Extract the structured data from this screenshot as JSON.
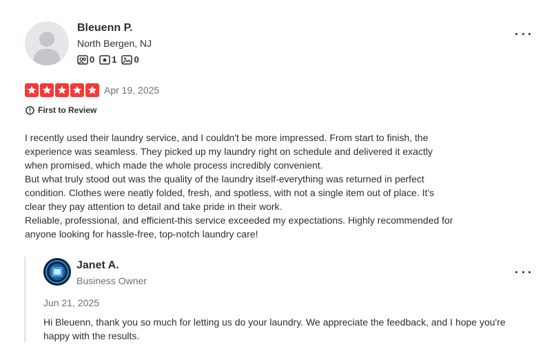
{
  "review": {
    "reviewer": {
      "name": "Bleuenn P.",
      "location": "North Bergen, NJ",
      "friends_count": "0",
      "reviews_count": "1",
      "photos_count": "0"
    },
    "rating": 5,
    "rating_max": 5,
    "date": "Apr 19, 2025",
    "badge": "First to Review",
    "text_lines": [
      "I recently used their laundry service, and I couldn't be more impressed. From start to finish, the",
      "experience was seamless. They picked up my laundry right on schedule and delivered it exactly",
      "when promised, which made the whole process incredibly convenient.",
      "But what truly stood out was the quality of the laundry itself-everything was returned in perfect",
      "condition. Clothes were neatly folded, fresh, and spotless, with not a single item out of place. It's",
      "clear they pay attention to detail and take pride in their work.",
      "Reliable, professional, and efficient-this service exceeded my expectations. Highly recommended for",
      "anyone looking for hassle-free, top-notch laundry care!"
    ]
  },
  "reply": {
    "name": "Janet A.",
    "role": "Business Owner",
    "date": "Jun 21, 2025",
    "text_lines": [
      "Hi Bleuenn, thank you so much for letting us do your laundry. We appreciate the feedback, and I hope you're",
      "happy with the results."
    ]
  },
  "colors": {
    "star": "#f43939",
    "text": "#2d2e2f",
    "muted": "#6e7072"
  },
  "icons": {
    "friends": "friends-icon",
    "reviews": "star-outline-icon",
    "photos": "photo-icon",
    "more": "more-options-icon",
    "badge": "first-to-review-icon"
  }
}
